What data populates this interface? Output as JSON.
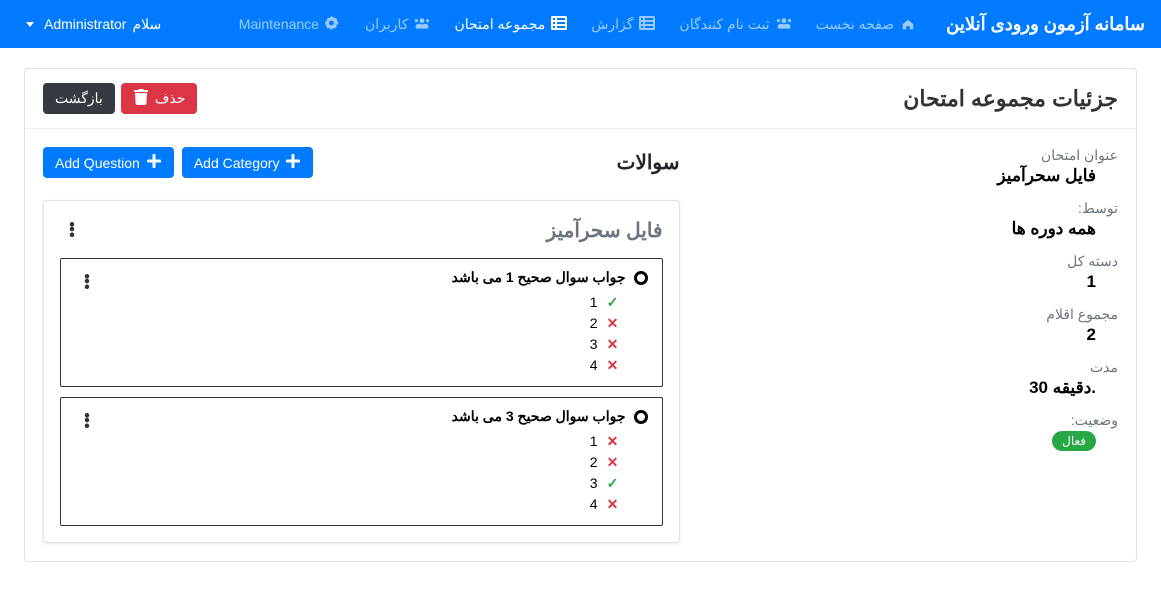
{
  "navbar": {
    "brand": "سامانه آزمون ورودی آنلاین",
    "items": [
      {
        "label": "صفحه نخست",
        "icon": "home"
      },
      {
        "label": "ثبت نام کنندگان",
        "icon": "users"
      },
      {
        "label": "گزارش",
        "icon": "list"
      },
      {
        "label": "مجموعه امتحان",
        "icon": "list"
      },
      {
        "label": "کاربران",
        "icon": "users"
      },
      {
        "label": "Maintenance",
        "icon": "gears"
      }
    ],
    "user_greeting": "سلام",
    "user_name": "Administrator"
  },
  "page": {
    "title": "جزئیات مجموعه امتحان",
    "back": "بازگشت",
    "delete": "حذف"
  },
  "details": {
    "title_label": "عنوان امتحان",
    "title_value": "فایل سحرآمیز",
    "by_label": "توسط:",
    "by_value": "همه دوره ها",
    "total_cat_label": "دسته کل",
    "total_cat_value": "1",
    "total_items_label": "مجموع اقلام",
    "total_items_value": "2",
    "duration_label": "مدت",
    "duration_value": ".دقیقه 30",
    "status_label": "وضعیت:",
    "status_value": "فعال"
  },
  "questions": {
    "heading": "سوالات",
    "add_category": "Add Category",
    "add_question": "Add Question",
    "category_title": "فایل سحرآمیز",
    "list": [
      {
        "text": "جواب سوال صحیح 1 می باشد",
        "options": [
          {
            "n": "1",
            "correct": true
          },
          {
            "n": "2",
            "correct": false
          },
          {
            "n": "3",
            "correct": false
          },
          {
            "n": "4",
            "correct": false
          }
        ]
      },
      {
        "text": "جواب سوال صحیح 3 می باشد",
        "options": [
          {
            "n": "1",
            "correct": false
          },
          {
            "n": "2",
            "correct": false
          },
          {
            "n": "3",
            "correct": true
          },
          {
            "n": "4",
            "correct": false
          }
        ]
      }
    ]
  }
}
